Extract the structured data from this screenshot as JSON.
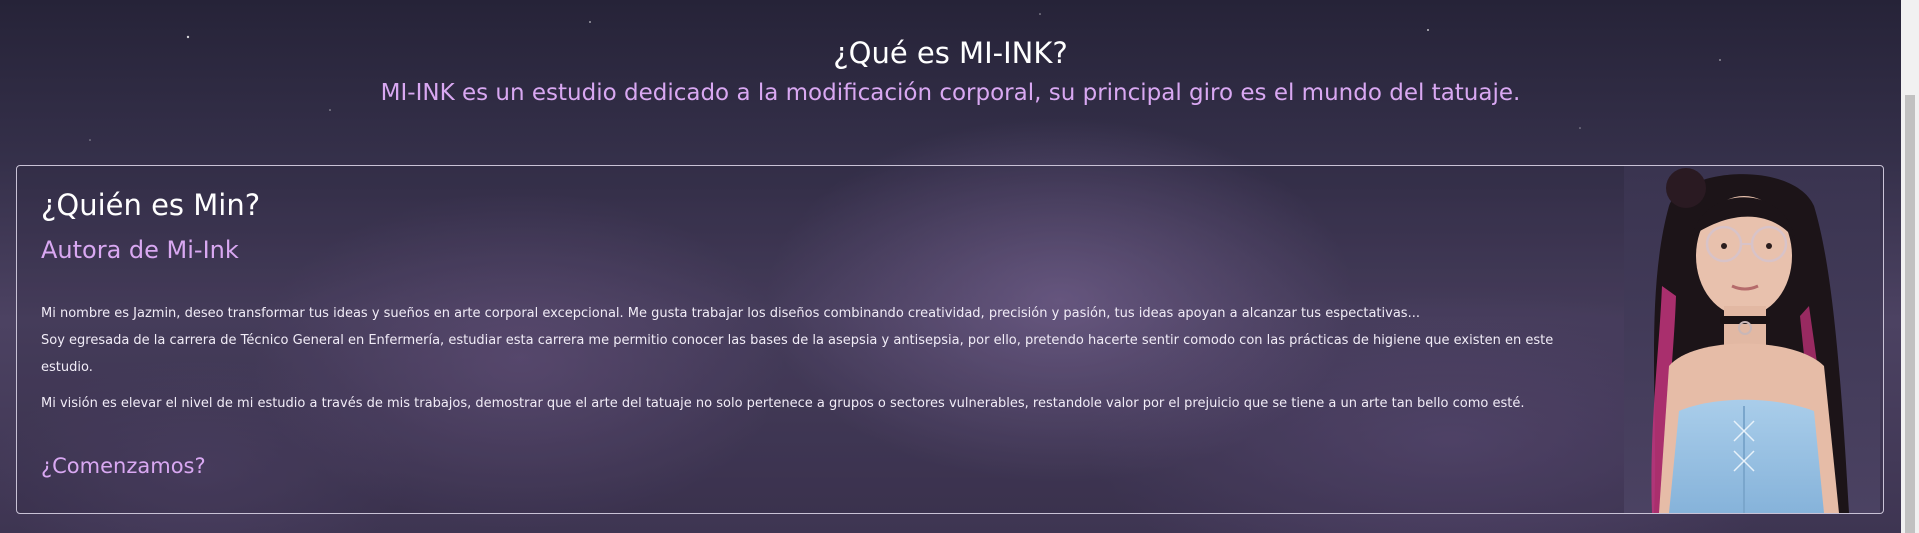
{
  "intro": {
    "title": "¿Qué es MI-INK?",
    "subtitle": "MI-INK es un estudio dedicado a la modificación corporal, su principal giro es el mundo del tatuaje."
  },
  "about": {
    "title": "¿Quién es Min?",
    "subtitle": "Autora de Mi-Ink",
    "paragraphs": {
      "p1": "Mi nombre es Jazmin, deseo transformar tus ideas y sueños en arte corporal excepcional. Me gusta trabajar los diseños combinando creatividad, precisión y pasión, tus ideas apoyan a alcanzar tus espectativas...",
      "p2": "Soy egresada de la carrera de Técnico General en Enfermería, estudiar esta carrera me permitio conocer las bases de la asepsia y antisepsia, por ello, pretendo hacerte sentir comodo con las prácticas de higiene que existen en este estudio.",
      "p3": "Mi visión es elevar el nivel de mi estudio a través de mis trabajos, demostrar que el arte del tatuaje no solo pertenece a grupos o sectores vulnerables, restandole valor por el prejuicio que se tiene a un arte tan bello como esté."
    },
    "cta": "¿Comenzamos?"
  },
  "colors": {
    "accent": "#d9a8f2",
    "heading": "#ffffff",
    "card_border": "#c9c2d6"
  }
}
